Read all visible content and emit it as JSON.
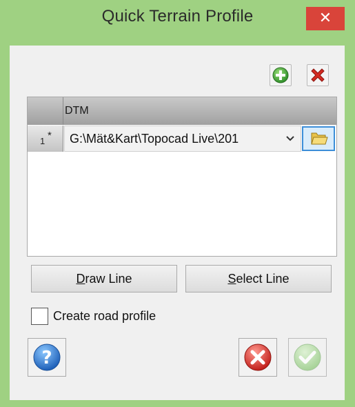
{
  "window": {
    "title": "Quick Terrain Profile",
    "close_glyph": "✕"
  },
  "toolbar": {
    "add_icon": "green-plus-icon",
    "remove_icon": "red-x-icon"
  },
  "grid": {
    "column_header": "DTM",
    "rows": [
      {
        "row_number": "1",
        "row_marker": "*",
        "dtm_path": "G:\\Mät&Kart\\Topocad Live\\201"
      }
    ]
  },
  "buttons": {
    "draw_line": "Draw Line",
    "select_line": "Select Line"
  },
  "options": {
    "create_road_profile_label": "Create road profile",
    "create_road_profile_checked": false
  },
  "footer": {
    "help_icon": "help-icon",
    "cancel_icon": "cancel-icon",
    "ok_icon": "ok-check-icon",
    "ok_enabled": false
  },
  "colors": {
    "frame": "#9fd182",
    "close": "#d9443a",
    "accent_blue": "#3c8ed8"
  }
}
